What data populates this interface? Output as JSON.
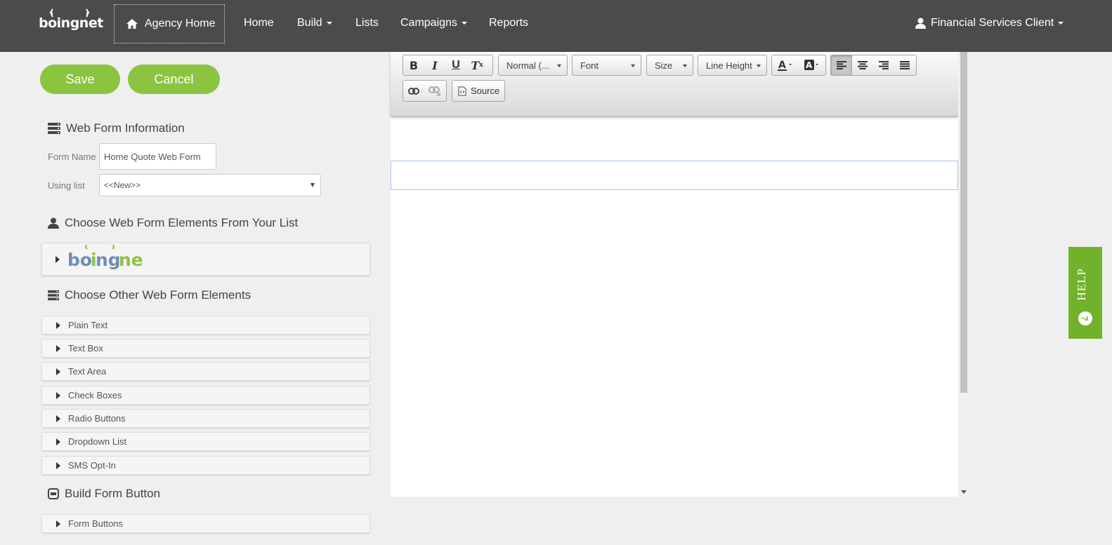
{
  "brand": {
    "name": "boingnet"
  },
  "nav": {
    "agency_home": "Agency Home",
    "items": [
      {
        "label": "Home",
        "dropdown": false
      },
      {
        "label": "Build",
        "dropdown": true
      },
      {
        "label": "Lists",
        "dropdown": false
      },
      {
        "label": "Campaigns",
        "dropdown": true
      },
      {
        "label": "Reports",
        "dropdown": false
      }
    ],
    "user": "Financial Services Client"
  },
  "actions": {
    "save": "Save",
    "cancel": "Cancel"
  },
  "web_form_info": {
    "title": "Web Form Information",
    "form_name_label": "Form Name",
    "form_name_value": "Home Quote Web Form",
    "using_list_label": "Using list",
    "using_list_value": "<<New>>"
  },
  "list_elements": {
    "title": "Choose Web Form Elements From Your List"
  },
  "other_elements": {
    "title": "Choose Other Web Form Elements",
    "items": [
      "Plain Text",
      "Text Box",
      "Text Area",
      "Check Boxes",
      "Radio Buttons",
      "Dropdown List",
      "SMS Opt-In"
    ]
  },
  "build_button": {
    "title": "Build Form Button",
    "items": [
      "Form Buttons"
    ]
  },
  "editor": {
    "format": "Normal (...",
    "font": "Font",
    "size": "Size",
    "line_height": "Line Height",
    "source": "Source"
  },
  "help": {
    "label": "HELP"
  },
  "colors": {
    "accent_green": "#8bc440",
    "nav_bg": "#4b4b4b",
    "help_green": "#72b22b"
  }
}
